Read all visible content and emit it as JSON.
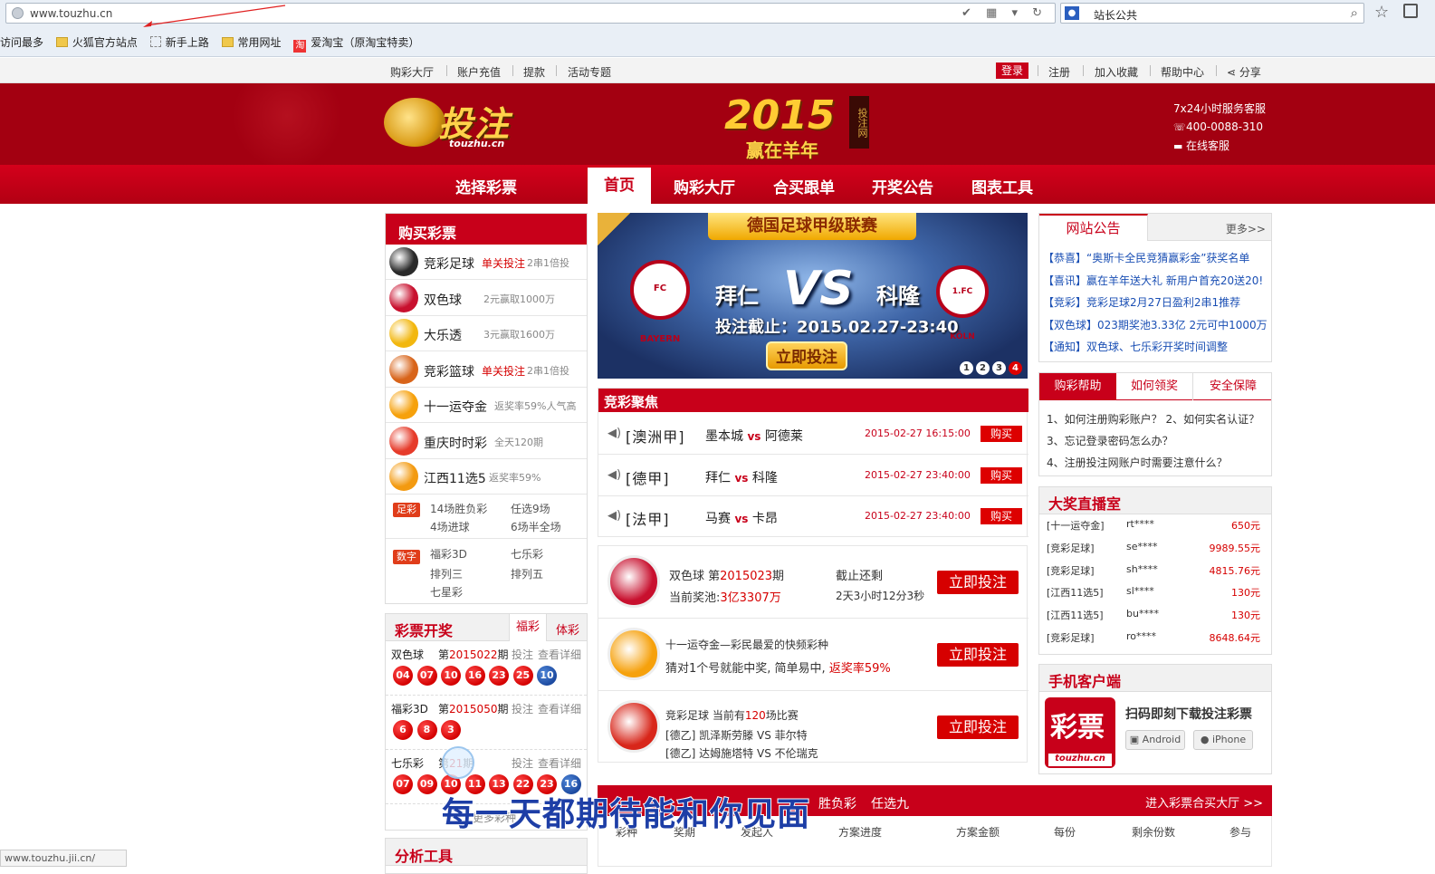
{
  "browser": {
    "url": "www.touzhu.cn",
    "search_value": "站长公共",
    "bookmarks": [
      "访问最多",
      "火狐官方站点",
      "新手上路",
      "常用网址",
      "爱淘宝（原淘宝特卖）"
    ],
    "status_text": "www.touzhu.jii.cn/"
  },
  "topbar": {
    "left": [
      "购彩大厅",
      "账户充值",
      "提款",
      "活动专题"
    ],
    "login": "登录",
    "right": [
      "注册",
      "加入收藏",
      "帮助中心",
      "分享"
    ]
  },
  "header": {
    "logo_text": "投注",
    "logo_sub": "touzhu.cn",
    "year": "2015",
    "slogan": "赢在羊年",
    "seal": "投注网",
    "service_title": "7x24小时服务客服",
    "phone": "400-0088-310",
    "online": "在线客服"
  },
  "nav": {
    "choose": "选择彩票",
    "items": [
      "首页",
      "购彩大厅",
      "合买跟单",
      "开奖公告",
      "图表工具"
    ]
  },
  "buy": {
    "title": "购买彩票",
    "rows": [
      {
        "name": "竞彩足球",
        "tag": "单关投注",
        "desc": "2串1倍投",
        "color": "#2a2a2a"
      },
      {
        "name": "双色球",
        "tag": "",
        "desc": "2元赢取1000万",
        "color": "#c8102e"
      },
      {
        "name": "大乐透",
        "tag": "",
        "desc": "3元赢取1600万",
        "color": "#f2b70f"
      },
      {
        "name": "竞彩篮球",
        "tag": "单关投注",
        "desc": "2串1倍投",
        "color": "#d8641a"
      },
      {
        "name": "十一运夺金",
        "tag": "",
        "desc": "返奖率59%人气高",
        "color": "#f6a10c"
      },
      {
        "name": "重庆时时彩",
        "tag": "",
        "desc": "全天120期",
        "color": "#e63b2a"
      },
      {
        "name": "江西11选5",
        "tag": "",
        "desc": "返奖率59%",
        "color": "#f39a10"
      }
    ],
    "zucai_label": "足彩",
    "zucai": [
      "14场胜负彩",
      "任选9场",
      "4场进球",
      "6场半全场"
    ],
    "shuzi_label": "数字",
    "shuzi": [
      "福彩3D",
      "七乐彩",
      "排列三",
      "排列五",
      "七星彩"
    ]
  },
  "draws": {
    "title": "彩票开奖",
    "tabs": [
      "福彩",
      "体彩"
    ],
    "items": [
      {
        "name": "双色球",
        "prefix": "第",
        "issue": "2015022",
        "suffix": "期",
        "links": [
          "投注",
          "查看详细"
        ],
        "reds": [
          "04",
          "07",
          "10",
          "16",
          "23",
          "25"
        ],
        "blues": [
          "10"
        ]
      },
      {
        "name": "福彩3D",
        "prefix": "第",
        "issue": "2015050",
        "suffix": "期",
        "links": [
          "投注",
          "查看详细"
        ],
        "reds": [
          "6",
          "8",
          "3"
        ],
        "blues": []
      },
      {
        "name": "七乐彩",
        "prefix": "第",
        "issue": "21",
        "suffix": "期",
        "links": [
          "投注",
          "查看详细"
        ],
        "reds": [
          "07",
          "09",
          "10",
          "11",
          "13",
          "22",
          "23"
        ],
        "blues": [
          "16"
        ]
      }
    ],
    "more": "更多彩种"
  },
  "tools": {
    "title": "分析工具"
  },
  "banner": {
    "league": "德国足球甲级联赛",
    "home": "拜仁",
    "away": "科隆",
    "vs": "VS",
    "home_badge": "FC BAYERN",
    "away_badge": "1.FC KÖLN",
    "deadline": "投注截止：2015.02.27-23:40",
    "button": "立即投注",
    "pages": [
      "1",
      "2",
      "3",
      "4"
    ]
  },
  "focus": {
    "title": "竞彩聚焦",
    "rows": [
      {
        "league": "[澳洲甲]",
        "home": "墨本城",
        "vs": "vs",
        "away": "阿德莱",
        "time": "2015-02-27 16:15:00",
        "buy": "购买"
      },
      {
        "league": "[德甲]",
        "home": "拜仁",
        "vs": "vs",
        "away": "科隆",
        "time": "2015-02-27 23:40:00",
        "buy": "购买"
      },
      {
        "league": "[法甲]",
        "home": "马赛",
        "vs": "vs",
        "away": "卡昂",
        "time": "2015-02-27 23:40:00",
        "buy": "购买"
      }
    ]
  },
  "featured": [
    {
      "logo_color": "#c8102e",
      "l1a": "双色球 第",
      "l1b": "2015023",
      "l1c": "期",
      "l2a": "当前奖池:",
      "l2b": "3亿3307万",
      "r1": "截止还剩",
      "r2": "2天3小时12分3秒",
      "button": "立即投注"
    },
    {
      "logo_color": "#f6a10c",
      "l1a": "十一运夺金—彩民最爱的快频彩种",
      "l2a": "猜对1个号就能中奖, 简单易中, ",
      "l2b": "返奖率59%",
      "button": "立即投注"
    },
    {
      "logo_color": "#d8261a",
      "l1a": "竞彩足球  当前有",
      "l1b": "120",
      "l1c": "场比赛",
      "l2a": "[德乙] 凯泽斯劳滕 VS 菲尔特",
      "l3a": "[德乙] 达姆施塔特 VS 不伦瑞克",
      "button": "立即投注"
    }
  ],
  "notice": {
    "title": "网站公告",
    "more": "更多>>",
    "items": [
      "【恭喜】“奥斯卡全民竞猜赢彩金”获奖名单",
      "【喜讯】赢在羊年送大礼 新用户首充20送20!",
      "【竞彩】竞彩足球2月27日盈利2串1推荐",
      "【双色球】023期奖池3.33亿 2元可中1000万",
      "【通知】双色球、七乐彩开奖时间调整"
    ]
  },
  "help": {
    "tabs": [
      "购彩帮助",
      "如何领奖",
      "安全保障"
    ],
    "lines": [
      "1、如何注册购彩账户？  2、如何实名认证？",
      "3、忘记登录密码怎么办？",
      "4、注册投注网账户时需要注意什么？"
    ]
  },
  "live": {
    "title": "大奖直播室",
    "items": [
      {
        "game": "[十一运夺金]",
        "user": "rt****",
        "amount": "650元"
      },
      {
        "game": "[竞彩足球]",
        "user": "se****",
        "amount": "9989.55元"
      },
      {
        "game": "[竞彩足球]",
        "user": "sh****",
        "amount": "4815.76元"
      },
      {
        "game": "[江西11选5]",
        "user": "sl****",
        "amount": "130元"
      },
      {
        "game": "[江西11选5]",
        "user": "bu****",
        "amount": "130元"
      },
      {
        "game": "[竞彩足球]",
        "user": "ro****",
        "amount": "8648.64元"
      }
    ]
  },
  "mobile": {
    "title": "手机客户端",
    "icon_text": "彩票",
    "icon_sub": "touzhu.cn",
    "desc": "扫码即刻下载投注彩票",
    "android": "Android",
    "iphone": "iPhone"
  },
  "hemai": {
    "tabs": [
      "胜负彩",
      "任选九"
    ],
    "more": "进入彩票合买大厅 >>",
    "cols": [
      "彩种",
      "奖期",
      "发起人",
      "方案进度",
      "方案金额",
      "每份",
      "剩余份数",
      "参与"
    ]
  },
  "overlay": {
    "caption": "每一天都期待能和你见面"
  }
}
